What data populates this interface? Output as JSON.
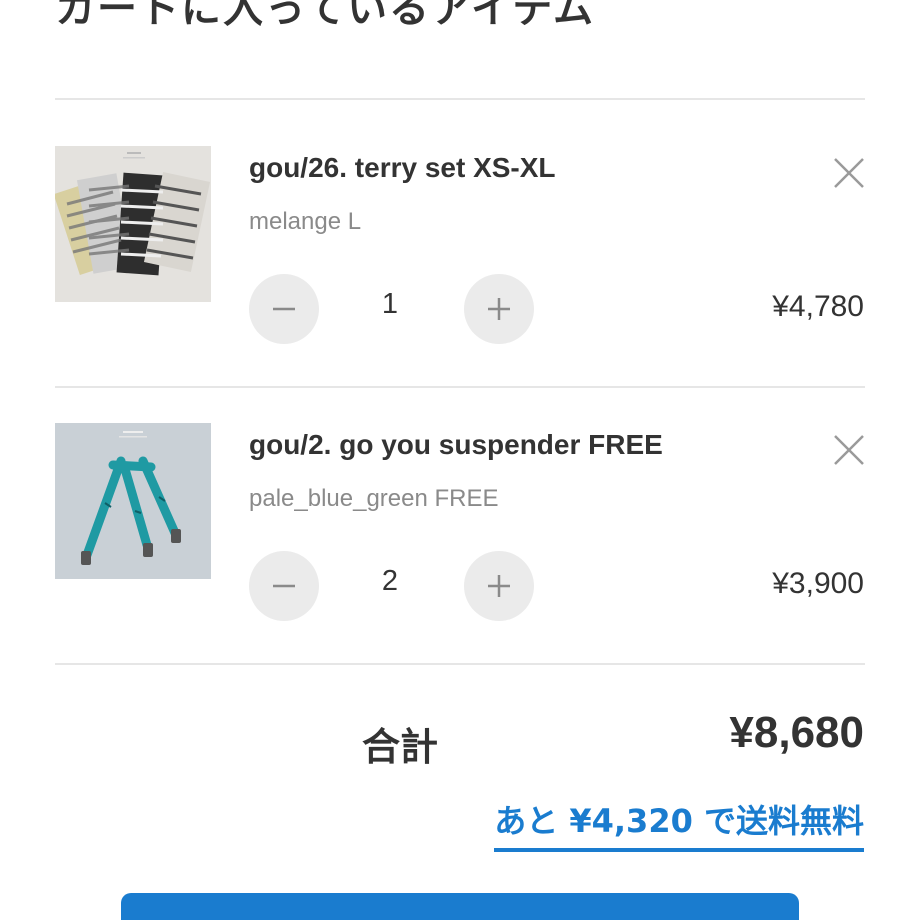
{
  "page": {
    "title": "カートに入っているアイテム"
  },
  "cart": {
    "items": [
      {
        "name": "gou/26. terry set XS-XL",
        "variant": "melange L",
        "quantity": "1",
        "price": "¥4,780",
        "image_icon": "striped-clothes-photo"
      },
      {
        "name": "gou/2. go you suspender FREE",
        "variant": "pale_blue_green FREE",
        "quantity": "2",
        "price": "¥3,900",
        "image_icon": "suspender-photo"
      }
    ]
  },
  "summary": {
    "total_label": "合計",
    "total_value": "¥8,680",
    "free_shipping_text": "あと ¥4,320 で送料無料"
  },
  "colors": {
    "accent": "#1a7ccf",
    "text": "#333333",
    "muted": "#8a8a8a",
    "button_bg": "#ebebeb"
  }
}
